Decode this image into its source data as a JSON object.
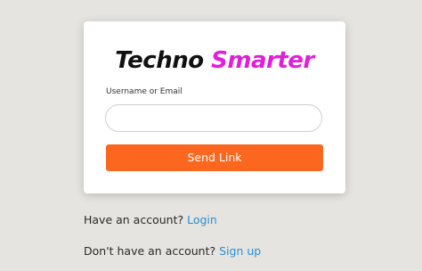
{
  "logo": {
    "part1": "Techno",
    "part2": "Smarter",
    "part1_color": "#111111",
    "part2_color": "#e020d8"
  },
  "form": {
    "label": "Username or Email",
    "input_value": "",
    "input_placeholder": "",
    "button_label": "Send Link",
    "button_color": "#fc6720"
  },
  "footer": {
    "login_prompt": "Have an account?",
    "login_link": "Login",
    "signup_prompt": "Don't have an account?",
    "signup_link": "Sign up",
    "link_color": "#2a8dd6"
  },
  "background_color": "#e5e4e0"
}
